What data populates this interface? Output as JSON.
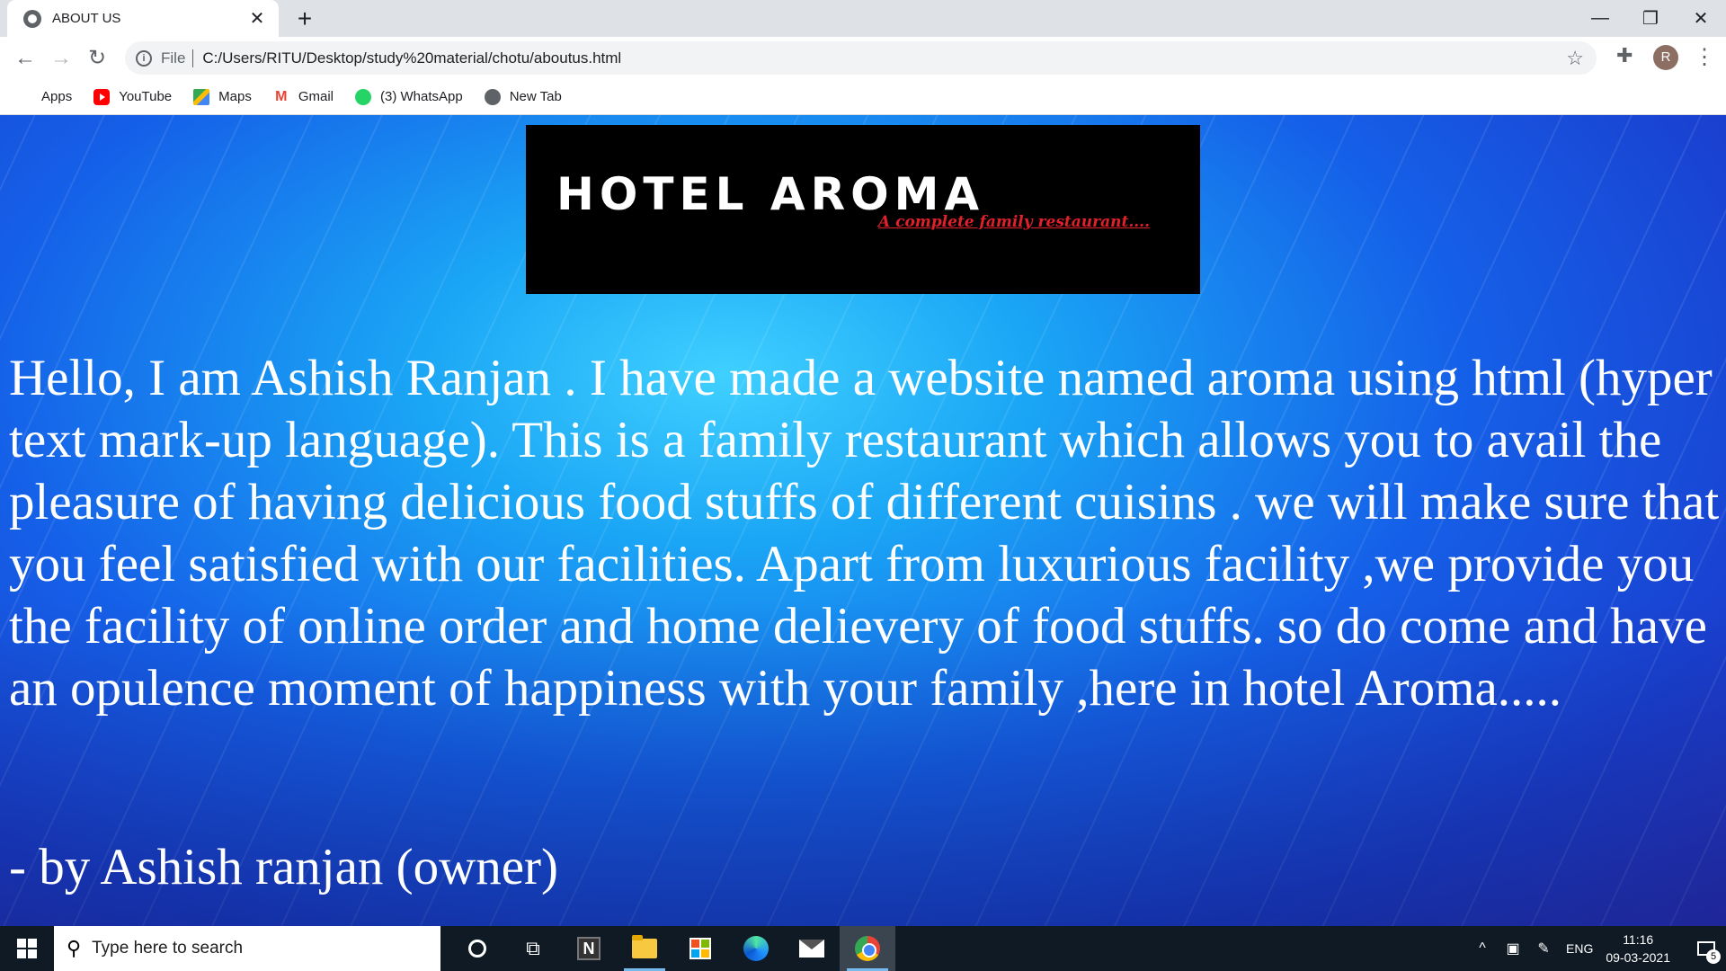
{
  "browser": {
    "tab_title": "ABOUT US",
    "tab_close": "✕",
    "new_tab": "+",
    "window_controls": {
      "minimize": "—",
      "restore": "❐",
      "close": "✕"
    },
    "nav": {
      "back": "←",
      "forward": "→",
      "reload": "↻"
    },
    "address": {
      "info_symbol": "i",
      "scheme": "File",
      "url": "C:/Users/RITU/Desktop/study%20material/chotu/aboutus.html",
      "star": "☆"
    },
    "extensions_icon": "✚",
    "profile_initial": "R",
    "menu": "⋮",
    "bookmarks": [
      {
        "label": "Apps",
        "icon": "apps-grid-icon"
      },
      {
        "label": "YouTube",
        "icon": "youtube-icon"
      },
      {
        "label": "Maps",
        "icon": "maps-icon"
      },
      {
        "label": "Gmail",
        "icon": "gmail-icon"
      },
      {
        "label": "(3) WhatsApp",
        "icon": "whatsapp-icon"
      },
      {
        "label": "New Tab",
        "icon": "globe-icon"
      }
    ]
  },
  "page": {
    "logo": {
      "title": "HOTEL AROMA",
      "tagline": "A complete family restaurant....",
      "title_color": "#ffffff",
      "tagline_color": "#e0202a"
    },
    "about_text": "Hello, I am Ashish Ranjan . I have made a website named aroma using html (hyper text mark-up language). This is a family restaurant which allows you to avail the pleasure of having delicious food stuffs of different cuisins . we will make sure that you feel satisfied with our facilities. Apart from luxurious facility ,we provide you the facility of online order and home delievery of food stuffs. so do come and have an opulence moment of happiness with your family ,here in hotel Aroma.....",
    "signature": "- by Ashish ranjan (owner)"
  },
  "taskbar": {
    "search_placeholder": "Type here to search",
    "search_icon": "⚲",
    "taskview_icon": "⧉",
    "gmail_letter": "M",
    "apps": [
      "cortana",
      "task-view",
      "n-app",
      "file-explorer",
      "microsoft-store",
      "edge",
      "mail",
      "chrome"
    ],
    "tray": {
      "chevron": "^",
      "meet_icon": "▣",
      "pen_icon": "✎",
      "language": "ENG",
      "time": "11:16",
      "date": "09-03-2021",
      "notification_count": "5"
    }
  }
}
